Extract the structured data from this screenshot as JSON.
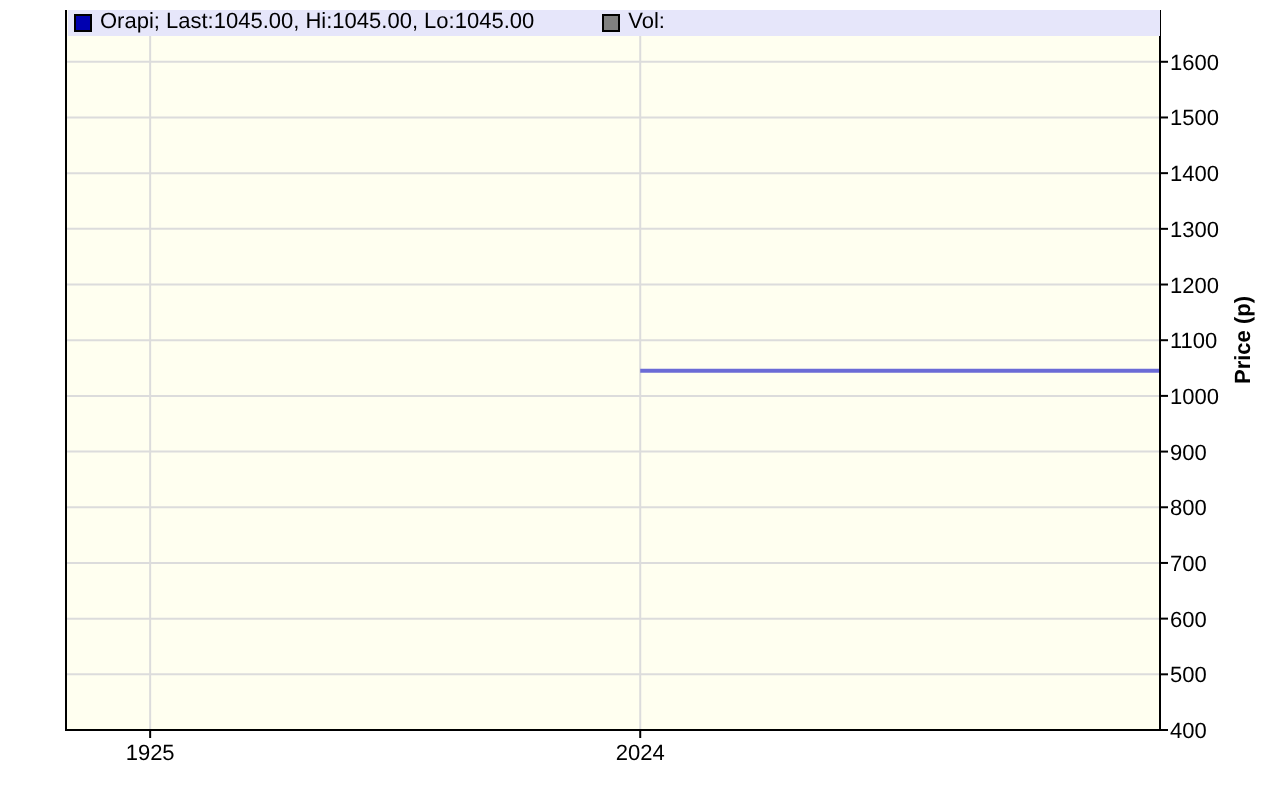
{
  "legend": [
    {
      "kind": "series",
      "detail": "; Last:1045.00, Hi:1045.00, Lo:1045.00",
      "color": "#0000b0"
    },
    {
      "kind": "plain",
      "label": "Vol:",
      "color": "#808080"
    }
  ],
  "chart_data": {
    "type": "line",
    "ylabel": "Price (p)",
    "grid": true,
    "xlim": [
      1908,
      2129
    ],
    "ylim": [
      400,
      1693
    ],
    "xticks": [
      1925,
      2024
    ],
    "yticks": [
      400,
      500,
      600,
      700,
      800,
      900,
      1000,
      1100,
      1200,
      1300,
      1400,
      1500,
      1600
    ],
    "series": [
      {
        "name": "Orapi",
        "color": "#6b6bd6",
        "x": [
          2024,
          2129
        ],
        "values": [
          1045,
          1045
        ]
      }
    ]
  }
}
